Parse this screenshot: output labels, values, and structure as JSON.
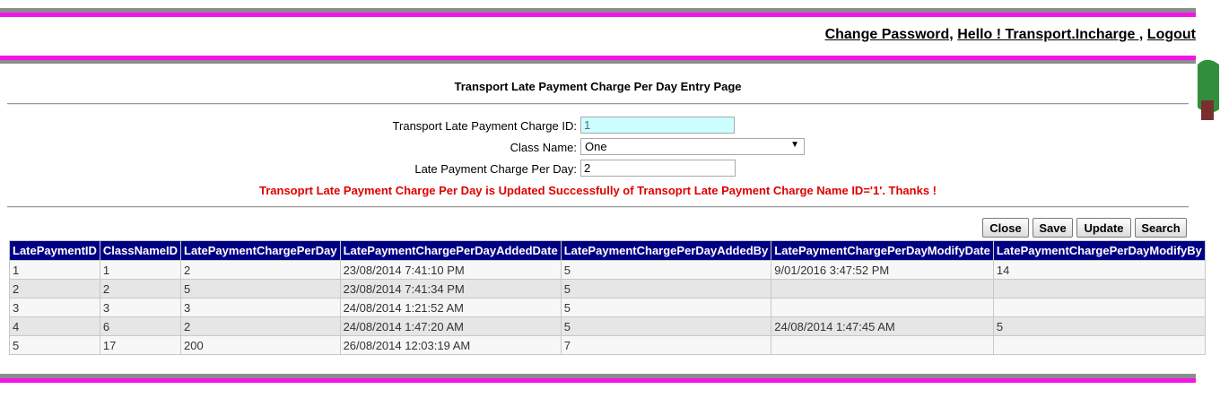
{
  "header": {
    "change_password": "Change Password,",
    "hello": "Hello ! Transport.Incharge ,",
    "logout": "Logout"
  },
  "page": {
    "title": "Transport Late Payment Charge Per Day Entry Page"
  },
  "form": {
    "id_label": "Transport Late Payment Charge ID:",
    "id_value": "1",
    "class_label": "Class Name:",
    "class_value": "One",
    "charge_label": "Late Payment Charge Per Day:",
    "charge_value": "2",
    "message": "Transoprt Late Payment Charge Per Day is Updated Successfully of Transoprt Late Payment Charge Name ID='1'. Thanks !"
  },
  "buttons": {
    "close": "Close",
    "save": "Save",
    "update": "Update",
    "search": "Search"
  },
  "table": {
    "headers": [
      "LatePaymentID",
      "ClassNameID",
      "LatePaymentChargePerDay",
      "LatePaymentChargePerDayAddedDate",
      "LatePaymentChargePerDayAddedBy",
      "LatePaymentChargePerDayModifyDate",
      "LatePaymentChargePerDayModifyBy"
    ],
    "rows": [
      [
        "1",
        "1",
        "2",
        "23/08/2014 7:41:10 PM",
        "5",
        "9/01/2016 3:47:52 PM",
        "14"
      ],
      [
        "2",
        "2",
        "5",
        "23/08/2014 7:41:34 PM",
        "5",
        "",
        ""
      ],
      [
        "3",
        "3",
        "3",
        "24/08/2014 1:21:52 AM",
        "5",
        "",
        ""
      ],
      [
        "4",
        "6",
        "2",
        "24/08/2014 1:47:20 AM",
        "5",
        "24/08/2014 1:47:45 AM",
        "5"
      ],
      [
        "5",
        "17",
        "200",
        "26/08/2014 12:03:19 AM",
        "7",
        "",
        ""
      ]
    ]
  },
  "colors": {
    "stripe_pink": "#f215e6",
    "stripe_gray": "#8c8c8c",
    "table_header": "#000084",
    "message": "#e00000"
  }
}
